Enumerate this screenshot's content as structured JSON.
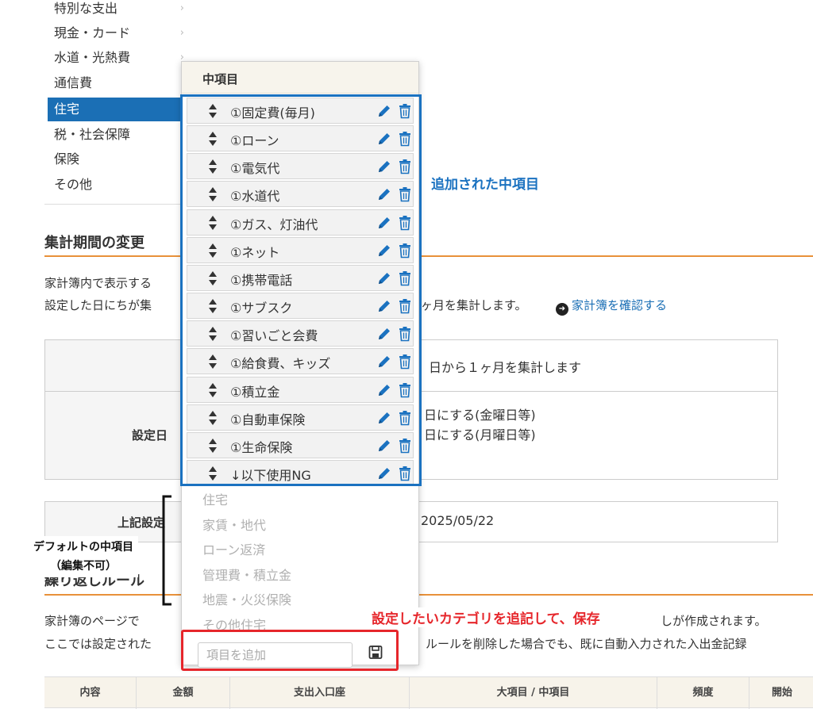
{
  "category_menu": {
    "items": [
      {
        "label": "特別な支出",
        "active": false,
        "has_arrow": true
      },
      {
        "label": "現金・カード",
        "active": false,
        "has_arrow": true
      },
      {
        "label": "水道・光熱費",
        "active": false,
        "has_arrow": true
      },
      {
        "label": "通信費",
        "active": false,
        "has_arrow": false
      },
      {
        "label": "住宅",
        "active": true,
        "has_arrow": false
      },
      {
        "label": "税・社会保障",
        "active": false,
        "has_arrow": false
      },
      {
        "label": "保険",
        "active": false,
        "has_arrow": false
      },
      {
        "label": "その他",
        "active": false,
        "has_arrow": false
      }
    ]
  },
  "period_section": {
    "title": "集計期間の変更",
    "desc_line1": "家計簿内で表示する",
    "desc_line2_left": "設定した日にちが集",
    "desc_line2_right": "ヶ月を集計します。",
    "link_text": "家計簿を確認する",
    "row1_value": "日から１ヶ月を集計します",
    "row2_label": "設定日",
    "row2_option1": "日にする(金曜日等)",
    "row2_option2": "日にする(月曜日等)",
    "row3_label": "上記設定",
    "row3_value": "2025/05/22"
  },
  "repeat_section": {
    "title": "繰り返しルール",
    "line1_left": "家計簿のページで",
    "line1_right": "しが作成されます。",
    "line2_left": "ここでは設定された",
    "line2_right": "ルールを削除した場合でも、既に自動入力された入出金記録"
  },
  "table_header": {
    "col_content": "内容",
    "col_amount": "金額",
    "col_account": "支出入口座",
    "col_category": "大項目 / 中項目",
    "col_frequency": "頻度",
    "col_start": "開始"
  },
  "dropdown": {
    "title": "中項目",
    "custom_items": [
      "①固定費(毎月)",
      "①ローン",
      "①電気代",
      "①水道代",
      "①ガス、灯油代",
      "①ネット",
      "①携帯電話",
      "①サブスク",
      "①習いごと会費",
      "①給食費、キッズ",
      "①積立金",
      "①自動車保険",
      "①生命保険",
      "↓以下使用NG"
    ],
    "default_items": [
      "住宅",
      "家賃・地代",
      "ローン返済",
      "管理費・積立金",
      "地震・火災保険",
      "その他住宅"
    ],
    "add_placeholder": "項目を追加",
    "add_value": ""
  },
  "annotations": {
    "blue_note": "追加された中項目",
    "red_note": "設定したいカテゴリを追記して、保存",
    "default_note_line1": "デフォルトの中項目",
    "default_note_line2": "（編集不可）"
  },
  "colors": {
    "accent_blue": "#1b72c0",
    "annotation_red": "#e6262b",
    "section_orange": "#e8913a",
    "active_menu": "#1b6fb5"
  }
}
